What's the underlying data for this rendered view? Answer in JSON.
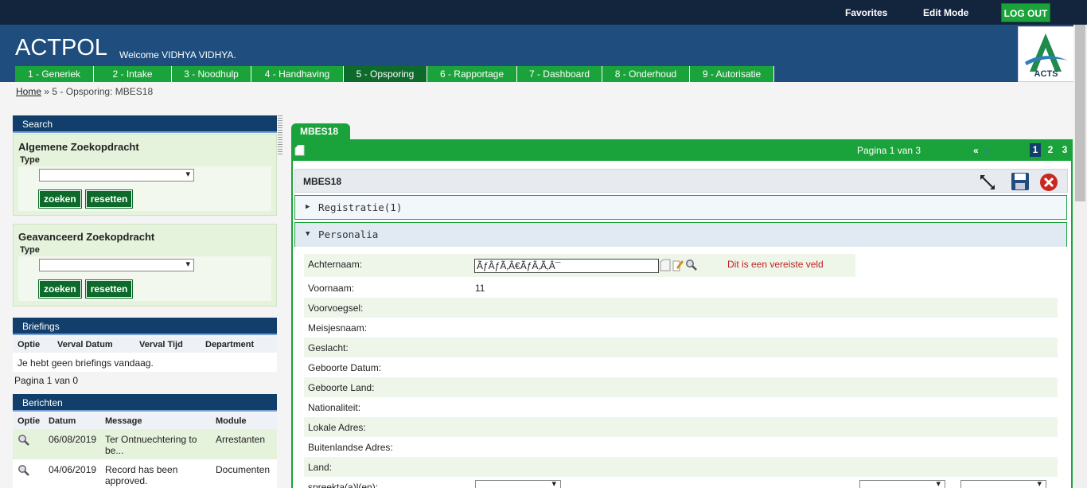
{
  "topbar": {
    "favorites": "Favorites",
    "edit_mode": "Edit Mode",
    "logout": "LOG OUT"
  },
  "header": {
    "brand": "ACTPOL",
    "welcome": "Welcome VIDHYA VIDHYA.",
    "logo_text": "ACTS"
  },
  "nav": {
    "tabs": [
      {
        "label": "1 - Generiek"
      },
      {
        "label": "2 - Intake"
      },
      {
        "label": "3 - Noodhulp"
      },
      {
        "label": "4 - Handhaving"
      },
      {
        "label": "5 - Opsporing"
      },
      {
        "label": "6 - Rapportage"
      },
      {
        "label": "7 - Dashboard"
      },
      {
        "label": "8 - Onderhoud"
      },
      {
        "label": "9 - Autorisatie"
      }
    ],
    "active_index": 4
  },
  "breadcrumb": {
    "home": "Home",
    "separator": "»",
    "current": "5 - Opsporing: MBES18"
  },
  "search": {
    "title": "Search",
    "basic": {
      "title": "Algemene Zoekopdracht",
      "type_label": "Type",
      "type_value": "",
      "search_btn": "zoeken",
      "reset_btn": "resetten"
    },
    "advanced": {
      "title": "Geavanceerd Zoekopdracht",
      "type_label": "Type",
      "type_value": "",
      "search_btn": "zoeken",
      "reset_btn": "resetten"
    }
  },
  "briefings": {
    "title": "Briefings",
    "columns": [
      "Optie",
      "Verval Datum",
      "Verval Tijd",
      "Department"
    ],
    "empty": "Je hebt geen briefings vandaag.",
    "pagination": "Pagina 1 van 0"
  },
  "berichten": {
    "title": "Berichten",
    "columns": [
      "Optie",
      "Datum",
      "Message",
      "Module"
    ],
    "rows": [
      {
        "date": "06/08/2019",
        "message_1": "Ter Ontnuechtering to",
        "message_2": "be...",
        "module": "Arrestanten"
      },
      {
        "date": "04/06/2019",
        "message_1": "Record has been",
        "message_2": "approved.",
        "module": "Documenten"
      }
    ]
  },
  "main": {
    "tab": "MBES18",
    "pagination": {
      "text": "Pagina 1 van 3",
      "first": "«",
      "prev": "»",
      "pages": [
        "1",
        "2",
        "3"
      ],
      "current": "1"
    },
    "form_title": "MBES18",
    "sections": {
      "registratie": "Registratie(1)",
      "personalia": "Personalia"
    },
    "fields": [
      {
        "label": "Achternaam:",
        "value": "ÃƒÂƒÃ‚Â€ÃƒÂ‚Ã‚Â¯"
      },
      {
        "label": "Voornaam:",
        "value": "11"
      },
      {
        "label": "Voorvoegsel:",
        "value": ""
      },
      {
        "label": "Meisjesnaam:",
        "value": ""
      },
      {
        "label": "Geslacht:",
        "value": ""
      },
      {
        "label": "Geboorte Datum:",
        "value": ""
      },
      {
        "label": "Geboorte Land:",
        "value": ""
      },
      {
        "label": "Nationaliteit:",
        "value": ""
      },
      {
        "label": "Lokale Adres:",
        "value": ""
      },
      {
        "label": "Buitenlandse Adres:",
        "value": ""
      },
      {
        "label": "Land:",
        "value": ""
      },
      {
        "label": "spreekta(a)l(en):",
        "value": ""
      }
    ],
    "achternaam_input": "ÃƒÂƒÃ‚Â€ÃƒÂ‚Ã‚Â¯",
    "required_msg": "Dit is een vereiste veld"
  },
  "colors": {
    "green": "#1aa33a",
    "dark_green": "#0d6a2a",
    "navy": "#123e6b",
    "header_blue": "#1e4d7e",
    "topbar": "#13253d",
    "error": "#c0211f"
  }
}
